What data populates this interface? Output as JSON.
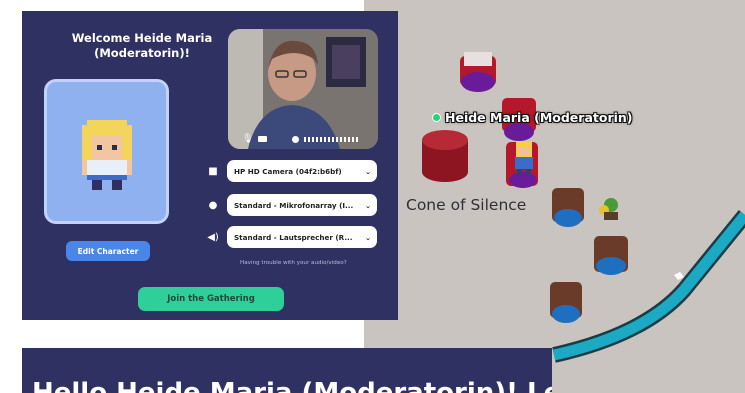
{
  "dialog": {
    "welcome": "Welcome Heide Maria (Moderatorin)!",
    "edit_character": "Edit Character",
    "camera": "HP HD Camera (04f2:b6bf)",
    "microphone": "Standard - Mikrofonarray (I...",
    "speaker": "Standard - Lautsprecher (R...",
    "trouble_text": "Having trouble with your audio/video?",
    "join_button": "Join the Gathering"
  },
  "map": {
    "player_name": "Heide Maria (Moderatorin)",
    "cone_label": "Cone of Silence"
  },
  "banner": {
    "text": "Hello Heide Maria (Moderatorin)! Let's"
  },
  "colors": {
    "dialog_bg": "#2f3162",
    "join_button": "#2fcf9a",
    "edit_button": "#4a86e8",
    "map_floor": "#c9c4bf",
    "path": "#1ba9c4"
  },
  "icons": [
    "camera-icon",
    "microphone-icon",
    "speaker-icon",
    "chevron-down-icon",
    "mic-toggle-icon",
    "video-toggle-icon",
    "audio-level-icon"
  ]
}
